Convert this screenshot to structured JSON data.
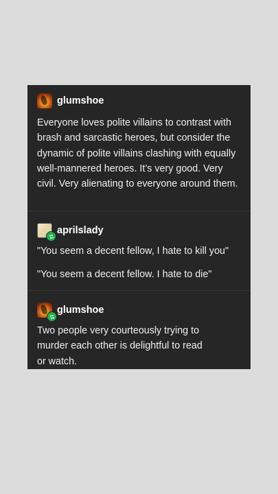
{
  "posts": [
    {
      "username": "glumshoe",
      "avatar_icon": "flame-avatar-icon",
      "paragraphs": [
        "Everyone loves polite villains to contrast with brash and sarcastic heroes, but consider the dynamic of polite villains clashing with equally well-mannered heroes. It’s very good. Very civil. Very alienating to everyone around them."
      ]
    },
    {
      "username": "aprilslady",
      "avatar_icon": "book-avatar-icon",
      "reblog_icon": "reblog-icon",
      "paragraphs": [
        "\"You seem a decent fellow, I hate to kill you\"",
        "\"You seem a decent fellow. I hate to die\""
      ]
    },
    {
      "username": "glumshoe",
      "avatar_icon": "flame-avatar-icon",
      "reblog_icon": "reblog-icon",
      "paragraphs": [
        "Two people very courteously trying to murder each other is delightful to read or watch."
      ]
    }
  ],
  "colors": {
    "background": "#dcdcdc",
    "card": "#262626",
    "text": "#f0f0f0",
    "reblog_badge": "#19b44b"
  }
}
